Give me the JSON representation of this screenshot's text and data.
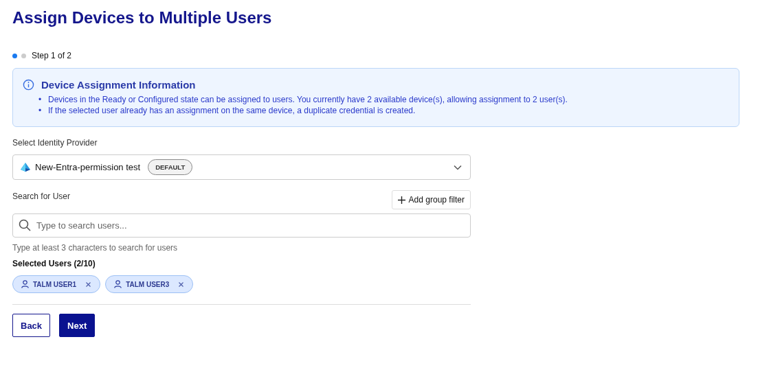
{
  "title": "Assign Devices to Multiple Users",
  "stepper": {
    "steps": [
      {
        "selected": true
      },
      {
        "selected": false
      }
    ],
    "label": "Step 1 of 2"
  },
  "info": {
    "title": "Device Assignment Information",
    "bullets": [
      {
        "marker": "•",
        "text": "Devices in the Ready or Configured state can be assigned to users. You currently have 2 available device(s), allowing assignment to 2 user(s)."
      },
      {
        "marker": "•",
        "text": "If the selected user already has an assignment on the same device, a duplicate credential is created."
      }
    ]
  },
  "provider": {
    "label": "Select Identity Provider",
    "value": "New-Entra-permission test",
    "badge": "DEFAULT"
  },
  "search": {
    "label": "Search for User",
    "filter_button": "Add group filter",
    "placeholder": "Type to search users...",
    "hint": "Type at least 3 characters to search for users"
  },
  "selected": {
    "label": "Selected Users (2/10)",
    "users": [
      "TALM USER1",
      "TALM USER3"
    ]
  },
  "buttons": {
    "back": "Back",
    "next": "Next"
  }
}
